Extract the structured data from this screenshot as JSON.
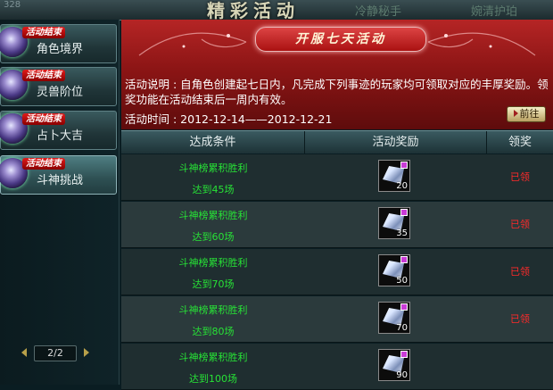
{
  "titlebar": {
    "coin_count": "328",
    "title": "精彩活动",
    "tab_left": "冷静秘手",
    "tab_right": "婉清护珀"
  },
  "sidebar": {
    "items": [
      {
        "badge": "活动结束",
        "label": "角色境界"
      },
      {
        "badge": "活动结束",
        "label": "灵兽阶位"
      },
      {
        "badge": "活动结束",
        "label": "占卜大吉"
      },
      {
        "badge": "活动结束",
        "label": "斗神挑战"
      }
    ],
    "pager": "2/2"
  },
  "banner": {
    "ribbon": "开服七天活动",
    "desc": "活动说明 : 自角色创建起七日内，凡完成下列事迹的玩家均可领取对应的丰厚奖励。领奖功能在活动结束后一周内有效。",
    "date": "活动时间 : 2012-12-14——2012-12-21",
    "go_label": "前往"
  },
  "table": {
    "headers": [
      "达成条件",
      "活动奖励",
      "领奖"
    ],
    "rows": [
      {
        "cond1": "斗神榜累积胜利",
        "cond2": "达到45场",
        "qty": "20",
        "status": "已领"
      },
      {
        "cond1": "斗神榜累积胜利",
        "cond2": "达到60场",
        "qty": "35",
        "status": "已领"
      },
      {
        "cond1": "斗神榜累积胜利",
        "cond2": "达到70场",
        "qty": "50",
        "status": "已领"
      },
      {
        "cond1": "斗神榜累积胜利",
        "cond2": "达到80场",
        "qty": "70",
        "status": "已领"
      },
      {
        "cond1": "斗神榜累积胜利",
        "cond2": "达到100场",
        "qty": "90",
        "status": ""
      }
    ]
  },
  "colors": {
    "banner_red": "#a01818",
    "condition_green": "#27e236",
    "status_red": "#ff2a2a"
  }
}
